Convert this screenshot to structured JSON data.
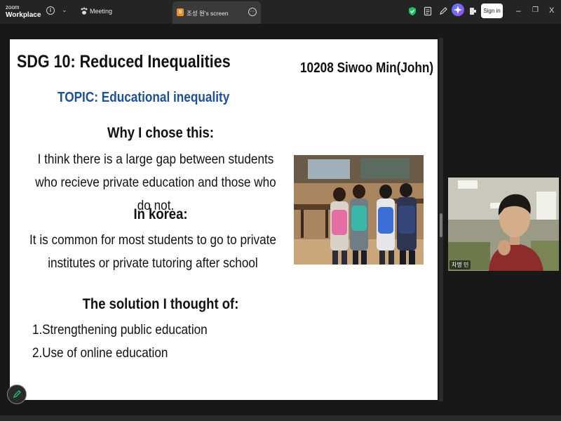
{
  "app": {
    "logo_line1": "zoom",
    "logo_line2": "Workplace"
  },
  "tabs": {
    "meeting_label": "Meeting",
    "share_badge": "S",
    "share_label": "조성 원's screen"
  },
  "header": {
    "sign_in_label": "Sign in",
    "minimize": "–",
    "restore": "❐",
    "close": "X"
  },
  "slide": {
    "title": "SDG 10: Reduced Inequalities",
    "author": "10208 Siwoo Min(John)",
    "topic": "TOPIC: Educational inequality",
    "why_heading": "Why I chose this:",
    "why_text": "I think there is a large gap between students who recieve private education and those who do not.",
    "korea_heading": "In korea:",
    "korea_text": "It is common for most students to go to private institutes or private tutoring after school",
    "solution_heading": "The solution I thought of:",
    "solutions": [
      {
        "num": "1.",
        "text": "Strengthening public education"
      },
      {
        "num": "2.",
        "text": "Use of online education"
      }
    ]
  },
  "video": {
    "participant_name": "차명 민"
  },
  "colors": {
    "topic": "#1f4f99",
    "accent_green": "#1fbf66",
    "signin_bg": "#ffffff"
  },
  "icons": [
    "info-icon",
    "chevron-down-icon",
    "paw-icon",
    "more-icon",
    "shield-icon",
    "document-icon",
    "pen-icon",
    "copilot-icon",
    "phone-icon",
    "annotate-icon"
  ]
}
